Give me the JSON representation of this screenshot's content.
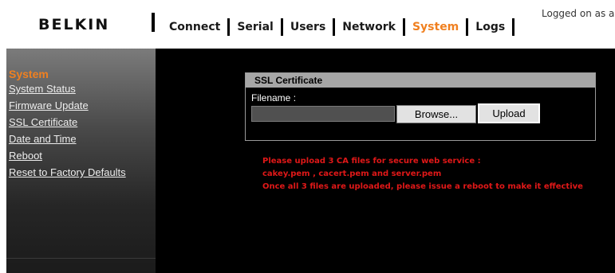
{
  "header": {
    "logo": "BELKIN",
    "nav": [
      {
        "label": "Connect",
        "active": false
      },
      {
        "label": "Serial",
        "active": false
      },
      {
        "label": "Users",
        "active": false
      },
      {
        "label": "Network",
        "active": false
      },
      {
        "label": "System",
        "active": true
      },
      {
        "label": "Logs",
        "active": false
      }
    ],
    "logged_on": "Logged on as a"
  },
  "sidebar": {
    "title": "System",
    "items": [
      {
        "label": "System Status"
      },
      {
        "label": "Firmware Update"
      },
      {
        "label": "SSL Certificate"
      },
      {
        "label": "Date and Time"
      },
      {
        "label": "Reboot"
      },
      {
        "label": "Reset to Factory Defaults"
      }
    ]
  },
  "main": {
    "panel_title": "SSL Certificate",
    "filename_label": "Filename :",
    "file_value": "",
    "browse_label": "Browse...",
    "upload_label": "Upload",
    "notice": [
      "Please upload 3 CA files for secure web service :",
      "cakey.pem , cacert.pem and server.pem",
      "Once all 3 files are uploaded, please issue a reboot to make it effective"
    ]
  },
  "colors": {
    "accent": "#f08020",
    "notice": "#e01818",
    "main_bg": "#000000"
  }
}
